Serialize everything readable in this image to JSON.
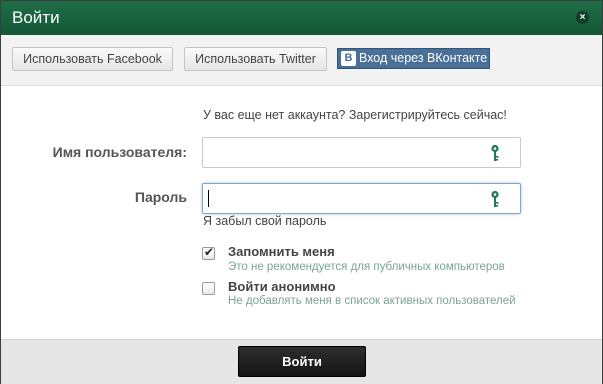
{
  "dialog": {
    "title": "Войти",
    "close_icon": "close-icon"
  },
  "social": {
    "facebook_label": "Использовать Facebook",
    "twitter_label": "Использовать Twitter",
    "vk_label": "Вход через ВКонтакте",
    "vk_logo": "B",
    "vk_color": "#4a7098"
  },
  "form": {
    "signup_prompt": "У вас еще нет аккаунта? Зарегистрируйтесь сейчас!",
    "username_label": "Имя пользователя:",
    "username_value": "",
    "password_label": "Пароль",
    "password_value": "",
    "field_icon": "key-icon",
    "forgot_link": "Я забыл свой пароль",
    "remember": {
      "title": "Запомнить меня",
      "subtitle": "Это не рекомендуется для публичных компьютеров",
      "checked": true
    },
    "anonymous": {
      "title": "Войти анонимно",
      "subtitle": "Не добавлять меня в список активных пользователей",
      "checked": false
    }
  },
  "footer": {
    "login_label": "Войти"
  },
  "colors": {
    "titlebar": "#1a6440",
    "key_icon": "#1f7a55",
    "hint_text": "#7ba39a"
  }
}
